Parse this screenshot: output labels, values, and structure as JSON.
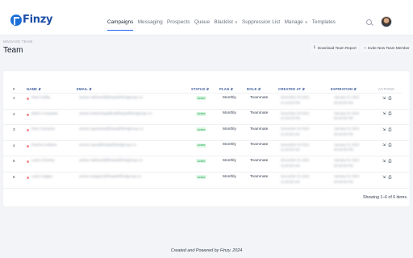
{
  "brand": {
    "name": "Finzy"
  },
  "nav": {
    "items": [
      {
        "label": "Campaigns",
        "active": true,
        "dropdown": false
      },
      {
        "label": "Messaging",
        "active": false,
        "dropdown": false
      },
      {
        "label": "Prospects",
        "active": false,
        "dropdown": false
      },
      {
        "label": "Queue",
        "active": false,
        "dropdown": false
      },
      {
        "label": "Blacklist",
        "active": false,
        "dropdown": true
      },
      {
        "label": "Suppression List",
        "active": false,
        "dropdown": false
      },
      {
        "label": "Manage",
        "active": false,
        "dropdown": true
      },
      {
        "label": "Templates",
        "active": false,
        "dropdown": false
      }
    ],
    "search_icon": "search-icon",
    "avatar_icon": "user-avatar"
  },
  "page": {
    "breadcrumb": "MANAGE TEAM",
    "title": "Team",
    "download_button": "Download Team Report",
    "invite_button": "Invite New Team Member"
  },
  "table": {
    "headers": {
      "index": "#",
      "name": "NAME",
      "email": "EMAIL",
      "status": "STATUS",
      "plan": "PLAN",
      "role": "ROLE",
      "created": "CREATED AT",
      "expiration": "EXPIRATION",
      "actions": "ACTIONS"
    },
    "rows": [
      {
        "index": "1",
        "name": "Ravi Kallaj",
        "email": "anisur.rakheed@thepathfindgroup.co",
        "status": "Active",
        "plan": "Monthly",
        "role": "Teammate",
        "created": "November 03 2021",
        "created_time": "01:20:03 PM",
        "expiration": "January 01 2023",
        "expiration_time": "06:30:00 PM",
        "actions": "⇲ ⎙"
      },
      {
        "index": "2",
        "name": "Baloo Hospade",
        "email": "anisur.rbaloohqadke@thepathfindgroup.co",
        "status": "Active",
        "plan": "Monthly",
        "role": "Teammate",
        "created": "November 03 2021",
        "created_time": "01:20:03 PM",
        "expiration": "January 01 2023",
        "expiration_time": "06:30:00 PM",
        "actions": "⇲ ⎙"
      },
      {
        "index": "3",
        "name": "Ravi Gaviana",
        "email": "anisur.rgaviana@thepathfindgroup.co",
        "status": "Active",
        "plan": "Monthly",
        "role": "Teammate",
        "created": "November 03 2021",
        "created_time": "11:20:03 AM",
        "expiration": "January 01 2023",
        "expiration_time": "06:30:00 PM",
        "actions": "⇲ ⎙"
      },
      {
        "index": "4",
        "name": "Ranha Indsare",
        "email": "anisur.rasa@thepathfindgroup.co",
        "status": "Active",
        "plan": "Monthly",
        "role": "Teammate",
        "created": "November 03 2021",
        "created_time": "11:20:03 AM",
        "expiration": "January 01 2023",
        "expiration_time": "06:30:00 PM",
        "actions": "⇲ ⎙"
      },
      {
        "index": "5",
        "name": "Lana Chmisa",
        "email": "anisur.rakheed@thepathfindgroup.co",
        "status": "Active",
        "plan": "Monthly",
        "role": "Teammate",
        "created": "December 01 2021",
        "created_time": "11:00:00 AM",
        "expiration": "January 01 2023",
        "expiration_time": "06:30:00 PM",
        "actions": "⇲ ⎙"
      },
      {
        "index": "6",
        "name": "Lana Sagpa",
        "email": "anisur.rpappin@thepathfindgroup.co",
        "status": "Active",
        "plan": "Monthly",
        "role": "Teammate",
        "created": "December 01 2021",
        "created_time": "11:00:00 AM",
        "expiration": "January 01 2023",
        "expiration_time": "06:30:00 PM",
        "actions": "⇲ ⎙"
      }
    ],
    "summary": "Showing 1–6 of 6 items."
  },
  "footer": {
    "text": "Created and Powered by Finzy. 2024"
  },
  "colors": {
    "brand": "#1d6fd8",
    "active_tab": "#2563eb",
    "status_active_bg": "#dff7e6",
    "status_active_text": "#16a34a"
  }
}
